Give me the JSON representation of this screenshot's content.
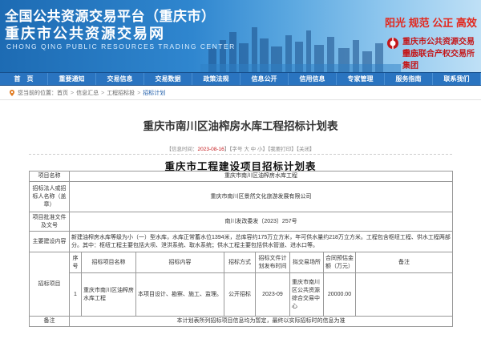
{
  "banner": {
    "title_line1": "全国公共资源交易平台（重庆市）",
    "title_line2": "重庆市公共资源交易网",
    "title_en": "CHONG QING PUBLIC RESOURCES TRADING CENTER",
    "slogan": "阳光 规范 公正 高效",
    "org_line1": "重庆市公共资源交易中心",
    "org_line2": "重庆联合产权交易所集团",
    "colors": {
      "banner_start": "#1d6bb3",
      "slogan": "#e4261b",
      "nav": "#2a74c0"
    }
  },
  "nav": {
    "items": [
      "首　页",
      "重要通知",
      "交易信息",
      "交易数据",
      "政策法规",
      "信息公开",
      "信用信息",
      "专家管理",
      "服务指南",
      "联系我们"
    ]
  },
  "breadcrumb": {
    "prefix": "您当前的位置：",
    "items": [
      "首页",
      "信息汇总",
      "工程招标投",
      "招标计划"
    ],
    "icon": "location-pin-icon"
  },
  "article": {
    "title": "重庆市南川区油榨房水库工程招标计划表",
    "meta_prefix": "【信息时间：",
    "meta_date": "2023-08-16",
    "meta_font": "】【字号 大 中 小】",
    "meta_print": "【我要打印】",
    "meta_close": "【关闭】",
    "doc_title": "重庆市工程建设项目招标计划表"
  },
  "table": {
    "project_name_label": "项目名称",
    "project_name": "重庆市南川区油榨房水库工程",
    "tenderer_label": "招标法人或招标人名称（盖章）",
    "tenderer": "重庆市南川区景然文化旅游发展有限公司",
    "approval_label": "项目批准文件及文号",
    "approval": "南川发改委发〔2023〕257号",
    "content_label": "主要建设内容",
    "content": "新建油榨房水库等级为小（一）型水库，水库正常蓄水位1394米，总库容约175万立方米，年可供水量约218万立方米。工程包含枢纽工程、供水工程两部分。其中：枢纽工程主要包括大坝、泄洪系统、取水系统；供水工程主要包括供水管道、进水口等。",
    "items_label": "招标项目",
    "headers": [
      "序号",
      "招标项目名称",
      "招标内容",
      "招标方式",
      "招标文件计划发布时间",
      "拟交易场所",
      "合同预估金额（万元）",
      "备注"
    ],
    "rows": [
      {
        "no": "1",
        "name": "重庆市南川区油榨房水库工程",
        "content": "本项目设计、勘察、施工、监理。",
        "method": "公开招标",
        "time": "2023-09",
        "venue": "重庆市南川区公共资源综合交易中心",
        "amount": "20000.00",
        "remark": ""
      }
    ],
    "remark_label": "备注",
    "remark": "本计划表所列招标项目信息均为暂定，最终以实际招标时的信息为准"
  }
}
